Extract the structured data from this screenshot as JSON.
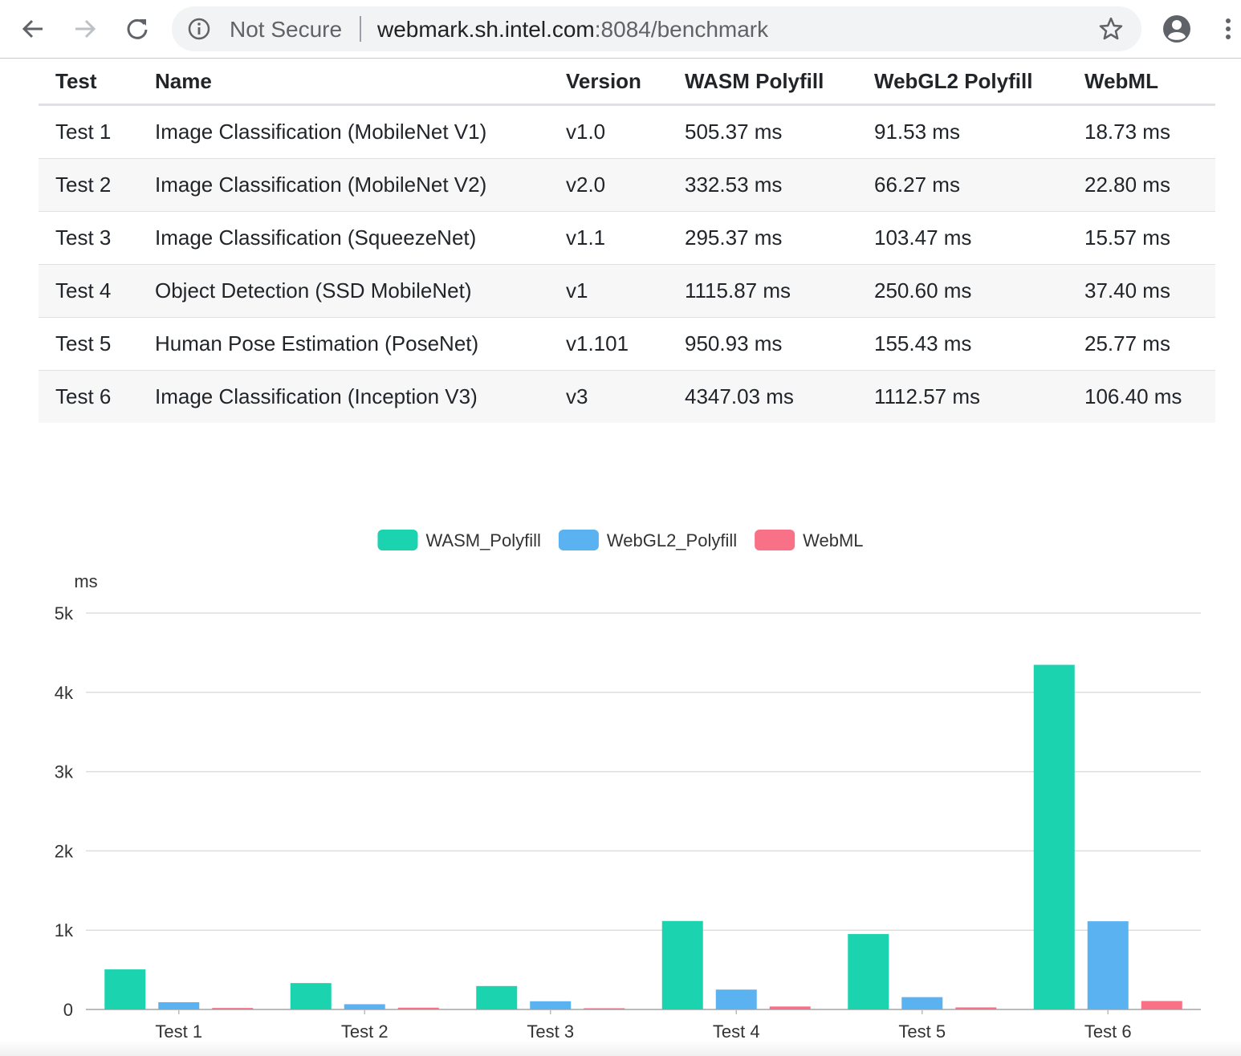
{
  "browser": {
    "security_label": "Not Secure",
    "url_host": "webmark.sh.intel.com",
    "url_rest": ":8084/benchmark"
  },
  "table": {
    "headers": [
      "Test",
      "Name",
      "Version",
      "WASM Polyfill",
      "WebGL2 Polyfill",
      "WebML"
    ],
    "rows": [
      [
        "Test 1",
        "Image Classification (MobileNet V1)",
        "v1.0",
        "505.37 ms",
        "91.53 ms",
        "18.73 ms"
      ],
      [
        "Test 2",
        "Image Classification (MobileNet V2)",
        "v2.0",
        "332.53 ms",
        "66.27 ms",
        "22.80 ms"
      ],
      [
        "Test 3",
        "Image Classification (SqueezeNet)",
        "v1.1",
        "295.37 ms",
        "103.47 ms",
        "15.57 ms"
      ],
      [
        "Test 4",
        "Object Detection (SSD MobileNet)",
        "v1",
        "1115.87 ms",
        "250.60 ms",
        "37.40 ms"
      ],
      [
        "Test 5",
        "Human Pose Estimation (PoseNet)",
        "v1.101",
        "950.93 ms",
        "155.43 ms",
        "25.77 ms"
      ],
      [
        "Test 6",
        "Image Classification (Inception V3)",
        "v3",
        "4347.03 ms",
        "1112.57 ms",
        "106.40 ms"
      ]
    ]
  },
  "chart_data": {
    "type": "bar",
    "categories": [
      "Test 1",
      "Test 2",
      "Test 3",
      "Test 4",
      "Test 5",
      "Test 6"
    ],
    "series": [
      {
        "name": "WASM_Polyfill",
        "color": "#1bd3ae",
        "values": [
          505.37,
          332.53,
          295.37,
          1115.87,
          950.93,
          4347.03
        ]
      },
      {
        "name": "WebGL2_Polyfill",
        "color": "#5bb2f0",
        "values": [
          91.53,
          66.27,
          103.47,
          250.6,
          155.43,
          1112.57
        ]
      },
      {
        "name": "WebML",
        "color": "#f87187",
        "values": [
          18.73,
          22.8,
          15.57,
          37.4,
          25.77,
          106.4
        ]
      }
    ],
    "ylabel": "ms",
    "yticks": [
      "0",
      "1k",
      "2k",
      "3k",
      "4k",
      "5k"
    ],
    "ylim": [
      0,
      5000
    ],
    "grid": true,
    "legend_position": "top-center"
  }
}
